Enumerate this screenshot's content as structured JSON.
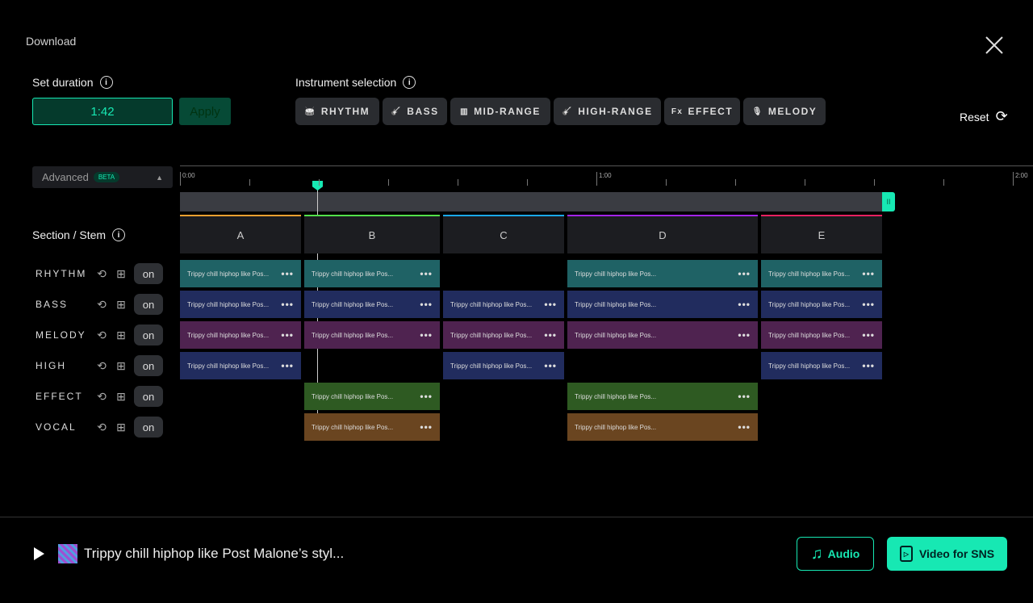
{
  "title": "Download",
  "duration": {
    "label": "Set duration",
    "value": "1:42",
    "apply": "Apply"
  },
  "instrument": {
    "label": "Instrument selection",
    "buttons": [
      {
        "label": "RHYTHM",
        "icon": "drum-icon",
        "glyph": "🥁"
      },
      {
        "label": "BASS",
        "icon": "bass-guitar-icon",
        "glyph": "🎸"
      },
      {
        "label": "MID-RANGE",
        "icon": "piano-icon",
        "glyph": "▥"
      },
      {
        "label": "HIGH-RANGE",
        "icon": "guitar-icon",
        "glyph": "🎸"
      },
      {
        "label": "EFFECT",
        "icon": "fx-icon",
        "glyph": "Fx"
      },
      {
        "label": "MELODY",
        "icon": "microphone-icon",
        "glyph": "🎙"
      }
    ]
  },
  "reset": "Reset",
  "advanced": {
    "label": "Advanced",
    "badge": "BETA"
  },
  "timeline": {
    "labels": [
      "0:00",
      "1:00",
      "2:00"
    ],
    "playhead": "0:20",
    "end": "1:41"
  },
  "section_stem": "Section / Stem",
  "sections": [
    {
      "name": "A",
      "color": "#f0a030"
    },
    {
      "name": "B",
      "color": "#52e04a"
    },
    {
      "name": "C",
      "color": "#1aa8e8"
    },
    {
      "name": "D",
      "color": "#a424e8"
    },
    {
      "name": "E",
      "color": "#e82060"
    }
  ],
  "clip_text": "Trippy chill hiphop like Pos...",
  "stems": [
    {
      "name": "RHYTHM",
      "toggle": "on",
      "color": "#1f6265",
      "sections": [
        0,
        1,
        3,
        4
      ]
    },
    {
      "name": "BASS",
      "toggle": "on",
      "color": "#212c5e",
      "sections": [
        0,
        1,
        2,
        3,
        4
      ]
    },
    {
      "name": "MELODY",
      "toggle": "on",
      "color": "#4f2350",
      "sections": [
        0,
        1,
        2,
        3,
        4
      ]
    },
    {
      "name": "HIGH",
      "toggle": "on",
      "color": "#212c5e",
      "sections": [
        0,
        2,
        4
      ]
    },
    {
      "name": "EFFECT",
      "toggle": "on",
      "color": "#2e5a22",
      "sections": [
        1,
        3
      ]
    },
    {
      "name": "VOCAL",
      "toggle": "on",
      "color": "#6a4520",
      "sections": [
        1,
        3
      ]
    }
  ],
  "footer": {
    "song": "Trippy chill hiphop like Post Malone’s styl...",
    "audio": "Audio",
    "video": "Video for SNS"
  },
  "accent": "#17e8b3"
}
